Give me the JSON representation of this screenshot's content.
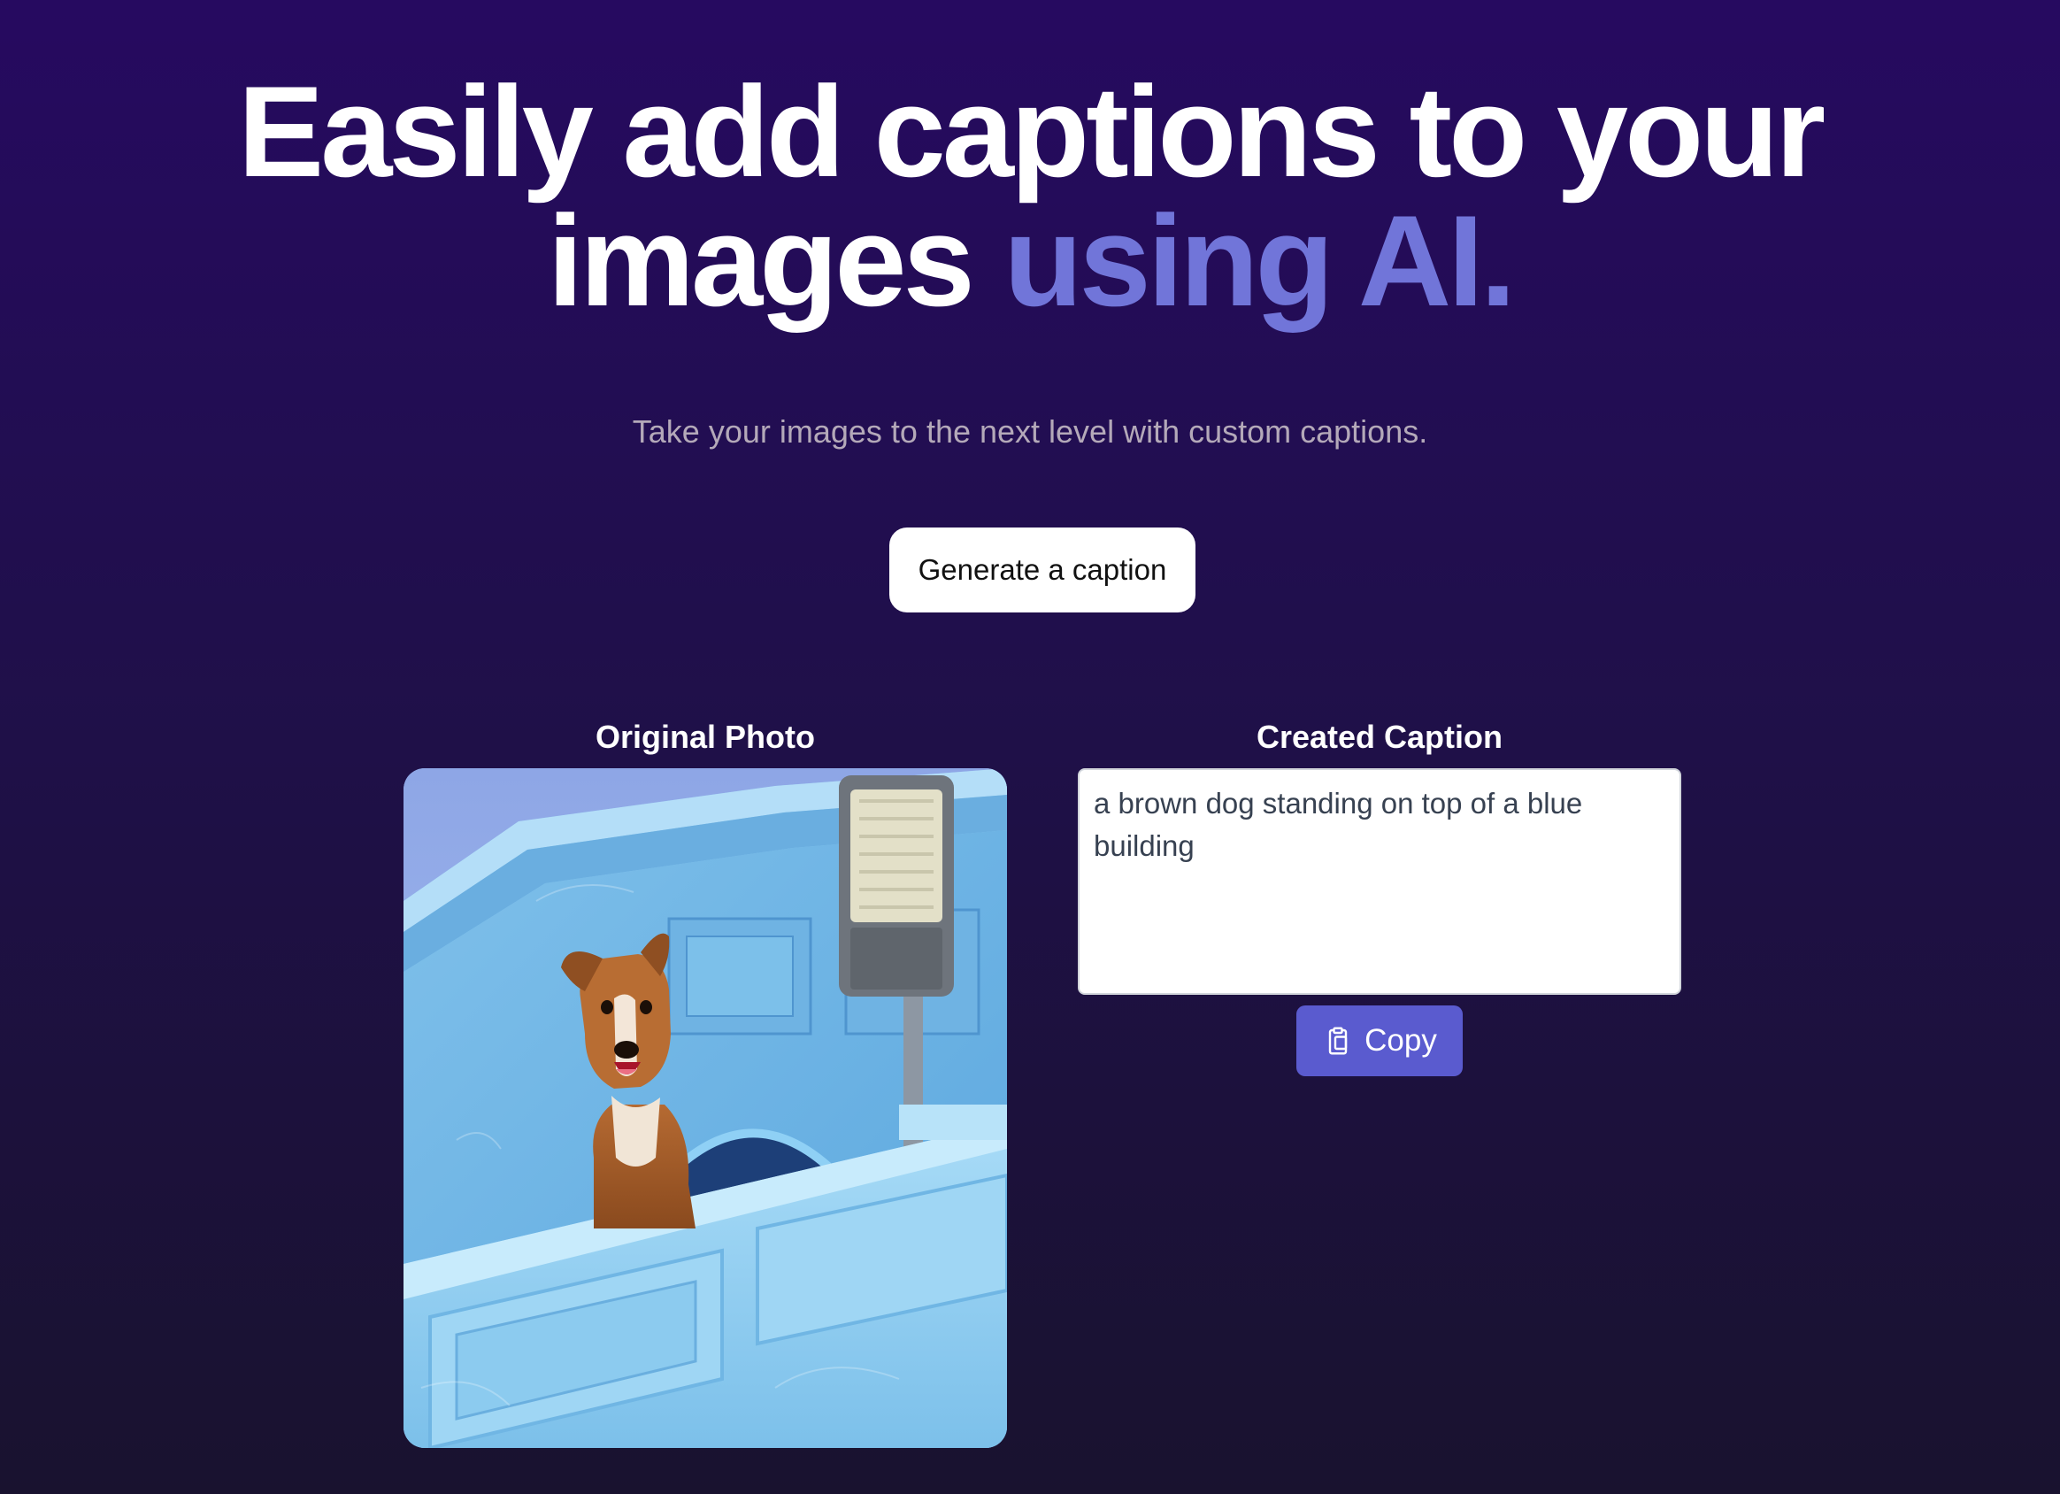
{
  "hero": {
    "title_line1": "Easily add captions to your",
    "title_line2_plain": "images ",
    "title_line2_accent": "using AI.",
    "subtitle": "Take your images to the next level with custom captions."
  },
  "actions": {
    "generate_label": "Generate a caption",
    "copy_label": "Copy",
    "copy_icon": "clipboard-copy-icon"
  },
  "photo_section": {
    "heading": "Original Photo",
    "image_description": "brown dog on blue building balcony with street lamp"
  },
  "caption_section": {
    "heading": "Created Caption",
    "caption_text": "a brown dog standing on top of a blue building"
  },
  "colors": {
    "background_top": "#260a60",
    "background_bottom": "#19122f",
    "accent": "#7175d9",
    "copy_button": "#5a5bcf",
    "subtitle_text": "#b4a9b9"
  }
}
